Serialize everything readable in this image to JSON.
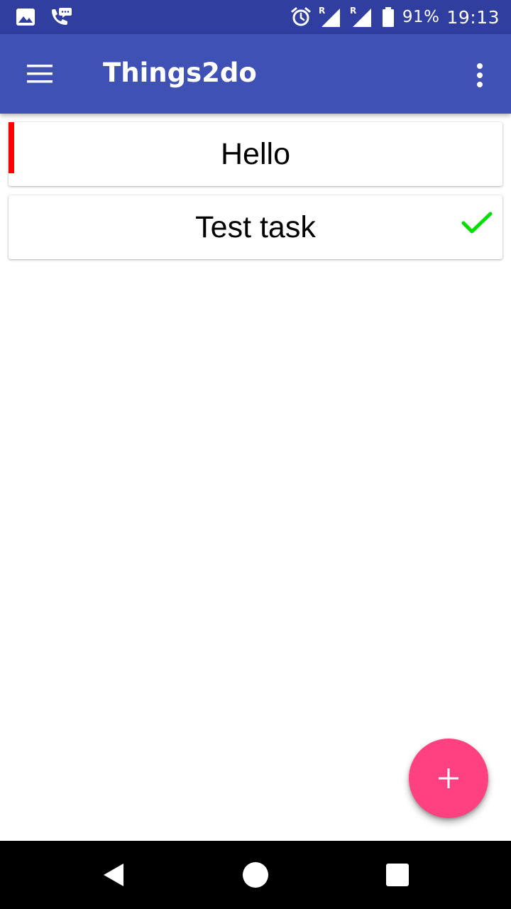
{
  "status_bar": {
    "left_icons": [
      "image-icon",
      "phone-chat-icon"
    ],
    "right_icons": [
      "alarm-icon",
      "signal-roaming-icon",
      "signal-roaming-icon",
      "battery-icon"
    ],
    "roaming_label": "R",
    "battery_percent": "91%",
    "time": "19:13",
    "color": "#303f9f"
  },
  "app_bar": {
    "title": "Things2do",
    "menu_icon": "hamburger-menu-icon",
    "overflow_icon": "more-vert-icon",
    "color": "#3f51b5"
  },
  "tasks": [
    {
      "title": "Hello",
      "priority_color": "#ff0000",
      "done": false
    },
    {
      "title": "Test task",
      "priority_color": null,
      "done": true,
      "check_color": "#00e000"
    }
  ],
  "fab": {
    "icon": "plus-icon",
    "color": "#ff4081"
  },
  "nav_bar": {
    "buttons": [
      "back-icon",
      "home-icon",
      "recents-icon"
    ],
    "color": "#000000"
  }
}
